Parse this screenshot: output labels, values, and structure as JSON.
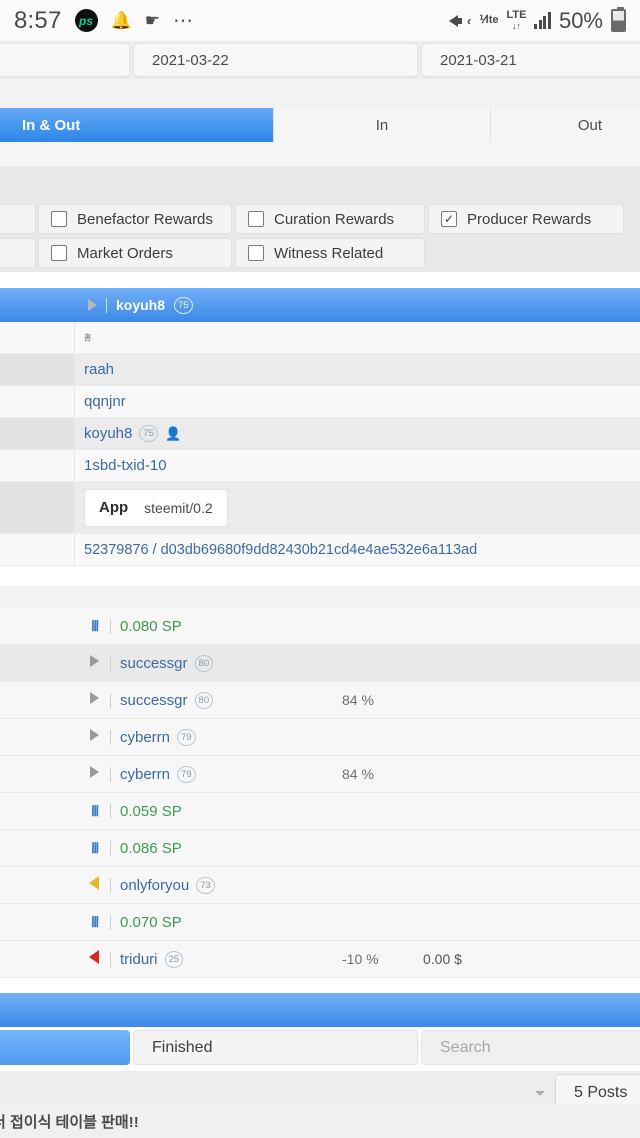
{
  "status_bar": {
    "time": "8:57",
    "app_badge": "ps",
    "icons": [
      "bell-icon",
      "location-icon",
      "more-dots-icon"
    ],
    "mute_icon": "volume-mute-icon",
    "vo_lte_label": "⅟lte",
    "lte_label": "LTE",
    "lte_sub": "↓↑",
    "signal_icon": "signal-bars-icon",
    "battery_percent": "50%"
  },
  "date_row": {
    "cells": [
      "",
      "2021-03-22",
      "2021-03-21"
    ]
  },
  "tabs": [
    {
      "label": "In & Out",
      "active": true
    },
    {
      "label": "In",
      "active": false
    },
    {
      "label": "Out",
      "active": false
    }
  ],
  "filters": [
    {
      "label": "",
      "checked": false
    },
    {
      "label": "Benefactor Rewards",
      "checked": false
    },
    {
      "label": "Curation Rewards",
      "checked": false
    },
    {
      "label": "Producer Rewards",
      "checked": true
    },
    {
      "label": "Market Orders",
      "checked": false
    },
    {
      "label": "Witness Related",
      "checked": false
    }
  ],
  "account_bar": {
    "expander_icon": "triangle-right-icon",
    "name": "koyuh8",
    "reputation": "75"
  },
  "detail_rows": [
    {
      "text": "홈",
      "kind": "korean"
    },
    {
      "text": "raah",
      "kind": "link"
    },
    {
      "text": "qqnjnr",
      "kind": "link"
    },
    {
      "text": "koyuh8",
      "kind": "link",
      "reputation": "75",
      "person_icon": "person-icon"
    },
    {
      "text": "1sbd-txid-10",
      "kind": "link"
    },
    {
      "kind": "app",
      "app_key": "App",
      "app_value": "steemit/0.2"
    },
    {
      "text": "52379876 / d03db69680f9dd82430b21cd4e4ae532e6a113ad",
      "kind": "hash"
    }
  ],
  "operations": [
    {
      "icon": "steem-logo-icon",
      "label": "0.080 SP",
      "kind": "sp",
      "pct": "",
      "usd": ""
    },
    {
      "icon": "triangle-right-icon",
      "label": "successgr",
      "kind": "account",
      "reputation": "80",
      "pct": "",
      "usd": ""
    },
    {
      "icon": "triangle-right-icon",
      "label": "successgr",
      "kind": "account",
      "reputation": "80",
      "pct": "84 %",
      "usd": ""
    },
    {
      "icon": "triangle-right-icon",
      "label": "cyberrn",
      "kind": "account",
      "reputation": "79",
      "pct": "",
      "usd": ""
    },
    {
      "icon": "triangle-right-icon",
      "label": "cyberrn",
      "kind": "account",
      "reputation": "79",
      "pct": "84 %",
      "usd": ""
    },
    {
      "icon": "steem-logo-icon",
      "label": "0.059 SP",
      "kind": "sp",
      "pct": "",
      "usd": ""
    },
    {
      "icon": "steem-logo-icon",
      "label": "0.086 SP",
      "kind": "sp",
      "pct": "",
      "usd": ""
    },
    {
      "icon": "triangle-left-gold-icon",
      "label": "onlyforyou",
      "kind": "account",
      "reputation": "73",
      "pct": "",
      "usd": ""
    },
    {
      "icon": "steem-logo-icon",
      "label": "0.070 SP",
      "kind": "sp",
      "pct": "",
      "usd": ""
    },
    {
      "icon": "triangle-left-red-icon",
      "label": "triduri",
      "kind": "account",
      "reputation": "25",
      "pct": "-10 %",
      "usd": "0.00 $"
    }
  ],
  "footer": {
    "primary_button_label": "",
    "status_field": "Finished",
    "search_placeholder": "Search",
    "dropdown_caret": "caret-down-icon",
    "posts_count": "5 Posts"
  },
  "korean_note": "더 접이식 테이블 판매!!",
  "colors": {
    "accent_blue": "#3d88e6",
    "link_blue": "#3c6aa5",
    "sp_green": "#3d9b52",
    "gold": "#e8b629",
    "red": "#cf2b22"
  }
}
